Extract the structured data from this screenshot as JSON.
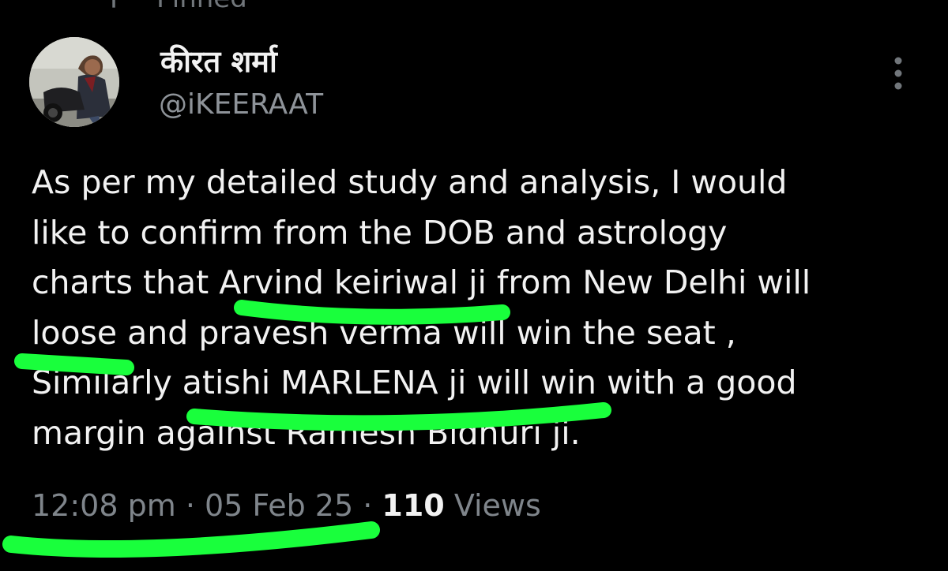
{
  "pinned": {
    "label": "Pinned",
    "icon": "pin-icon"
  },
  "author": {
    "name": "कीरत शर्मा",
    "handle": "@iKEERAAT",
    "avatar_icon": "profile-photo"
  },
  "more_icon": "more-vertical-icon",
  "tweet": {
    "lines": [
      "As per my detailed study and analysis, I would",
      "like to confirm from the DOB and astrology",
      "charts that Arvind keiriwal ji from New Delhi will",
      "loose and pravesh verma will win the seat ,",
      "Similarly atishi MARLENA ji will win with a good",
      "margin against Ramesh Bidhuri ji."
    ]
  },
  "meta": {
    "time": "12:08 pm",
    "separator": " · ",
    "date": "05 Feb 25",
    "views_count": "110",
    "views_label": "Views"
  },
  "colors": {
    "background": "#000000",
    "text_primary": "#f2f2f2",
    "text_secondary": "#7f858b",
    "highlight_marker": "#19ff3c"
  }
}
